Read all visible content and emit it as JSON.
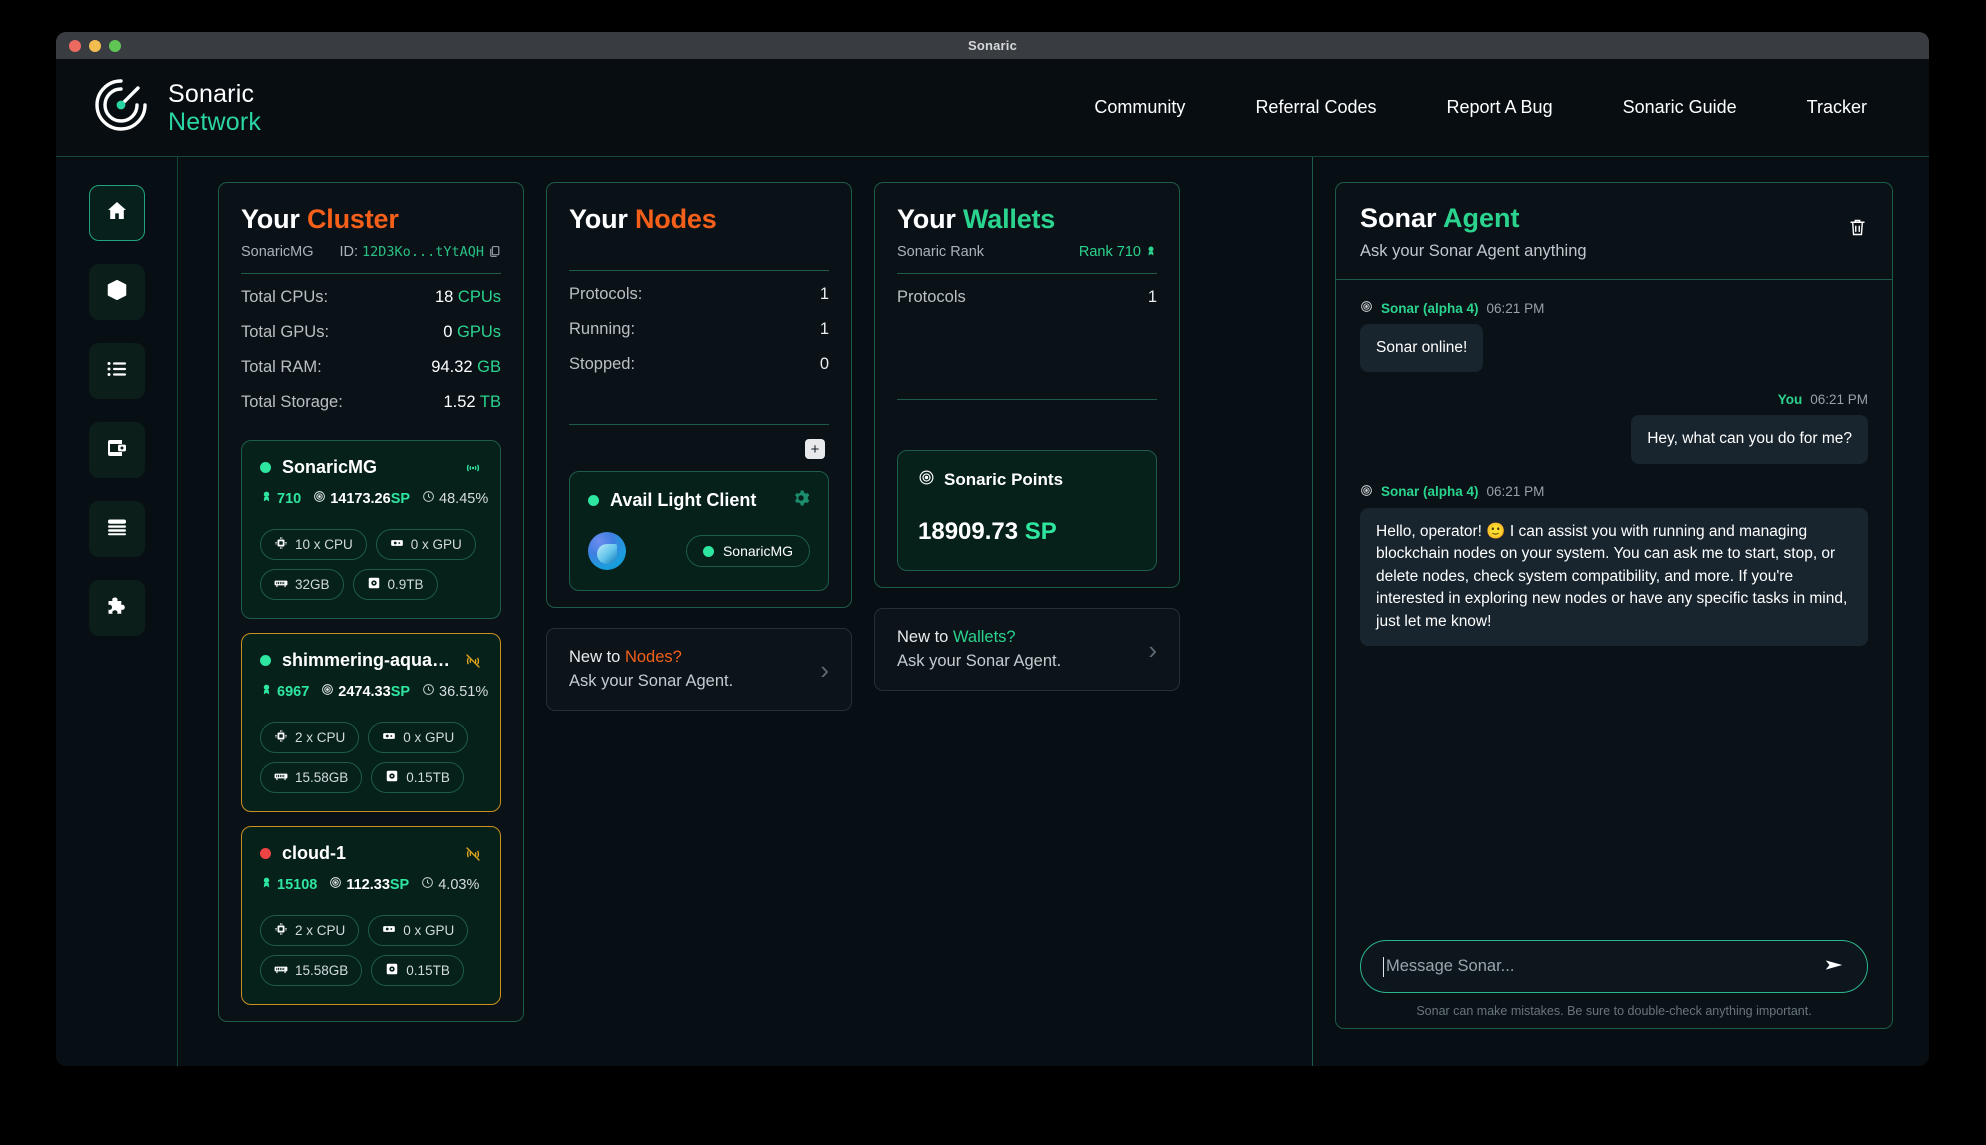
{
  "window": {
    "title": "Sonaric"
  },
  "header": {
    "brand_line1": "Sonaric",
    "brand_line2": "Network",
    "nav": [
      {
        "label": "Community"
      },
      {
        "label": "Referral Codes"
      },
      {
        "label": "Report A Bug"
      },
      {
        "label": "Sonaric Guide"
      },
      {
        "label": "Tracker"
      }
    ]
  },
  "sidebar": {
    "items": [
      {
        "icon": "home-icon",
        "active": true
      },
      {
        "icon": "cube-icon",
        "active": false
      },
      {
        "icon": "list-icon",
        "active": false
      },
      {
        "icon": "wallet-icon",
        "active": false
      },
      {
        "icon": "server-stack-icon",
        "active": false
      },
      {
        "icon": "puzzle-icon",
        "active": false
      }
    ]
  },
  "cluster": {
    "title_plain": "Your ",
    "title_accent": "Cluster",
    "name": "SonaricMG",
    "id_label": "ID: ",
    "id_value": "12D3Ko...tYtAQH",
    "stats": [
      {
        "key": "Total CPUs:",
        "value": "18",
        "unit": " CPUs"
      },
      {
        "key": "Total GPUs:",
        "value": "0",
        "unit": " GPUs"
      },
      {
        "key": "Total RAM:",
        "value": "94.32",
        "unit": " GB"
      },
      {
        "key": "Total Storage:",
        "value": "1.52",
        "unit": " TB"
      }
    ],
    "nodes": [
      {
        "name": "SonaricMG",
        "status": "on",
        "signal": "online",
        "rank": "710",
        "sp": "14173.26",
        "sp_unit": "SP",
        "pct": "48.45%",
        "chips": [
          {
            "icon": "cpu-icon",
            "label": "10 x CPU"
          },
          {
            "icon": "gpu-icon",
            "label": "0 x GPU"
          },
          {
            "icon": "ram-icon",
            "label": "32GB"
          },
          {
            "icon": "disk-icon",
            "label": "0.9TB"
          }
        ]
      },
      {
        "name": "shimmering-aquamarine…",
        "status": "on",
        "signal": "offline",
        "rank": "6967",
        "sp": "2474.33",
        "sp_unit": "SP",
        "pct": "36.51%",
        "chips": [
          {
            "icon": "cpu-icon",
            "label": "2 x CPU"
          },
          {
            "icon": "gpu-icon",
            "label": "0 x GPU"
          },
          {
            "icon": "ram-icon",
            "label": "15.58GB"
          },
          {
            "icon": "disk-icon",
            "label": "0.15TB"
          }
        ]
      },
      {
        "name": "cloud-1",
        "status": "off",
        "signal": "offline",
        "rank": "15108",
        "sp": "112.33",
        "sp_unit": "SP",
        "pct": "4.03%",
        "chips": [
          {
            "icon": "cpu-icon",
            "label": "2 x CPU"
          },
          {
            "icon": "gpu-icon",
            "label": "0 x GPU"
          },
          {
            "icon": "ram-icon",
            "label": "15.58GB"
          },
          {
            "icon": "disk-icon",
            "label": "0.15TB"
          }
        ]
      }
    ]
  },
  "nodes_panel": {
    "title_plain": "Your ",
    "title_accent": "Nodes",
    "stats": [
      {
        "key": "Protocols:",
        "value": "1"
      },
      {
        "key": "Running:",
        "value": "1"
      },
      {
        "key": "Stopped:",
        "value": "0"
      }
    ],
    "add_label": "+",
    "node_card": {
      "title": "Avail Light Client",
      "status": "on",
      "gear": "gear-icon",
      "cluster_chip": "SonaricMG"
    },
    "promo": {
      "line1_plain": "New to ",
      "line1_accent": "Nodes?",
      "line2": "Ask your Sonar Agent.",
      "arrow": "›"
    }
  },
  "wallets_panel": {
    "title_plain": "Your ",
    "title_accent": "Wallets",
    "rank_label": "Sonaric Rank",
    "rank_value": "Rank 710",
    "stats": [
      {
        "key": "Protocols",
        "value": "1"
      }
    ],
    "points": {
      "title": "Sonaric Points",
      "value": "18909.73",
      "unit": "SP"
    },
    "promo": {
      "line1_plain": "New to ",
      "line1_accent": "Wallets?",
      "line2": "Ask your Sonar Agent.",
      "arrow": "›"
    }
  },
  "agent": {
    "title_plain": "Sonar ",
    "title_accent": "Agent",
    "subtitle": "Ask your Sonar Agent anything",
    "delete_icon": "trash-icon",
    "messages": [
      {
        "role": "agent",
        "who": "Sonar (alpha 4)",
        "time": "06:21 PM",
        "text": "Sonar online!"
      },
      {
        "role": "user",
        "who": "You",
        "time": "06:21 PM",
        "text": "Hey, what can you do for me?"
      },
      {
        "role": "agent",
        "who": "Sonar (alpha 4)",
        "time": "06:21 PM",
        "text": "Hello, operator! 🙂 I can assist you with running and managing blockchain nodes on your system. You can ask me to start, stop, or delete nodes, check system compatibility, and more. If you're interested in exploring new nodes or have any specific tasks in mind, just let me know!"
      }
    ],
    "input_placeholder": "Message Sonar...",
    "send_icon": "send-icon",
    "disclaimer": "Sonar can make mistakes. Be sure to double-check anything important."
  },
  "colors": {
    "accent_green": "#2bd48e",
    "accent_orange": "#f4601a",
    "border_green": "#1d5b4a",
    "warn_border": "#c9901f",
    "status_on": "#2ee6a0",
    "status_off": "#ef4444"
  }
}
